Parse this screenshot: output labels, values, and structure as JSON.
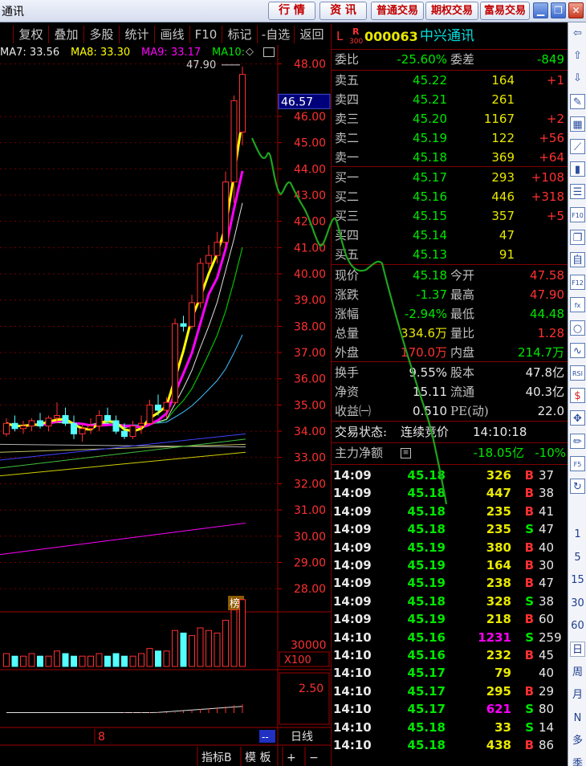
{
  "app": {
    "title_fragment": "通讯"
  },
  "titlebar": {
    "buttons": [
      "行 情",
      "资 讯",
      "普通交易",
      "期权交易",
      "富易交易"
    ],
    "window_controls": [
      "minimize-icon",
      "restore-icon",
      "close-icon"
    ]
  },
  "menu": [
    "复权",
    "叠加",
    "多股",
    "统计",
    "画线",
    "F10",
    "标记",
    "-自选",
    "返回"
  ],
  "ma_legend": [
    {
      "label": "MA7: 33.56",
      "color": "#e8e8e8"
    },
    {
      "label": "MA8: 33.30",
      "color": "#ffff00"
    },
    {
      "label": "MA9: 33.17",
      "color": "#ff00ff"
    },
    {
      "label": "MA10: ",
      "color": "#00e600"
    }
  ],
  "chart_data": {
    "type": "candlestick",
    "price_axis_ticks": [
      "48.00",
      "46.00",
      "45.00",
      "44.00",
      "43.00",
      "42.00",
      "41.00",
      "40.00",
      "39.00",
      "38.00",
      "37.00",
      "36.00",
      "35.00",
      "34.00",
      "33.00",
      "32.00",
      "31.00",
      "30.00",
      "29.00",
      "28.00"
    ],
    "price_range": [
      27.3,
      48.6
    ],
    "current_price_tag": "46.57",
    "high_marker": "47.90",
    "badge": "榜",
    "volume_axis_label": "30000",
    "volume_unit": "X100",
    "indicator_axis_label": "2.50",
    "x_axis_label": "8",
    "period_label": "日线",
    "bottom_buttons": [
      "指标B",
      "模 板",
      "+",
      "−"
    ],
    "scroll_marker": "--",
    "candles": [
      [
        33.9,
        34.5,
        33.8,
        34.3
      ],
      [
        34.3,
        34.6,
        34.0,
        34.1
      ],
      [
        34.1,
        34.4,
        33.9,
        34.2
      ],
      [
        34.2,
        34.5,
        34.0,
        34.4
      ],
      [
        34.4,
        34.7,
        34.1,
        34.2
      ],
      [
        34.2,
        34.6,
        34.0,
        34.5
      ],
      [
        34.5,
        35.1,
        34.3,
        34.6
      ],
      [
        34.6,
        34.9,
        34.2,
        34.3
      ],
      [
        34.3,
        34.6,
        33.7,
        33.9
      ],
      [
        33.9,
        34.3,
        33.6,
        34.1
      ],
      [
        34.1,
        34.5,
        33.9,
        34.2
      ],
      [
        34.2,
        34.8,
        34.0,
        34.6
      ],
      [
        34.6,
        34.9,
        34.3,
        34.4
      ],
      [
        34.4,
        34.6,
        33.9,
        34.0
      ],
      [
        34.0,
        34.3,
        33.7,
        33.8
      ],
      [
        33.8,
        34.4,
        33.7,
        34.2
      ],
      [
        34.2,
        34.6,
        33.9,
        34.3
      ],
      [
        34.3,
        35.2,
        34.2,
        35.0
      ],
      [
        35.0,
        35.4,
        34.6,
        34.8
      ],
      [
        34.8,
        35.3,
        34.5,
        35.1
      ],
      [
        35.1,
        38.3,
        35.0,
        38.1
      ],
      [
        38.1,
        38.4,
        37.8,
        38.0
      ],
      [
        38.0,
        39.2,
        37.9,
        38.9
      ],
      [
        38.9,
        40.6,
        38.7,
        40.4
      ],
      [
        40.4,
        41.1,
        40.2,
        40.7
      ],
      [
        40.7,
        41.6,
        40.4,
        41.2
      ],
      [
        41.2,
        43.9,
        41.0,
        43.5
      ],
      [
        43.5,
        46.8,
        42.7,
        46.6
      ],
      [
        45.4,
        47.9,
        44.9,
        47.6
      ]
    ],
    "volume": [
      5,
      4,
      4,
      5,
      4,
      4,
      6,
      5,
      4,
      4,
      4,
      5,
      4,
      5,
      4,
      4,
      5,
      7,
      6,
      6,
      14,
      13,
      12,
      15,
      14,
      13,
      18,
      22,
      26
    ],
    "annotation_color": "#1fa31f"
  },
  "quote": {
    "prefix": "L",
    "badge_top": "R",
    "badge_bottom": "300",
    "code": "000063",
    "name": "中兴通讯",
    "weibi_label": "委比",
    "weibi": "-25.60%",
    "weicha_label": "委差",
    "weicha": "-849",
    "asks": [
      {
        "label": "卖五",
        "price": "45.22",
        "vol": "164",
        "chg": "+1"
      },
      {
        "label": "卖四",
        "price": "45.21",
        "vol": "261",
        "chg": ""
      },
      {
        "label": "卖三",
        "price": "45.20",
        "vol": "1167",
        "chg": "+2"
      },
      {
        "label": "卖二",
        "price": "45.19",
        "vol": "122",
        "chg": "+56"
      },
      {
        "label": "卖一",
        "price": "45.18",
        "vol": "369",
        "chg": "+64"
      }
    ],
    "bids": [
      {
        "label": "买一",
        "price": "45.17",
        "vol": "293",
        "chg": "+108"
      },
      {
        "label": "买二",
        "price": "45.16",
        "vol": "446",
        "chg": "+318"
      },
      {
        "label": "买三",
        "price": "45.15",
        "vol": "357",
        "chg": "+5"
      },
      {
        "label": "买四",
        "price": "45.14",
        "vol": "47",
        "chg": ""
      },
      {
        "label": "买五",
        "price": "45.13",
        "vol": "91",
        "chg": ""
      }
    ],
    "stats": [
      {
        "l1": "现价",
        "v1": "45.18",
        "c1": "g",
        "l2": "今开",
        "v2": "47.58",
        "c2": "rd"
      },
      {
        "l1": "涨跌",
        "v1": "-1.37",
        "c1": "g",
        "l2": "最高",
        "v2": "47.90",
        "c2": "rd"
      },
      {
        "l1": "涨幅",
        "v1": "-2.94%",
        "c1": "g",
        "l2": "最低",
        "v2": "44.48",
        "c2": "g"
      },
      {
        "l1": "总量",
        "v1": "334.6万",
        "c1": "y",
        "l2": "量比",
        "v2": "1.28",
        "c2": "rd"
      },
      {
        "l1": "外盘",
        "v1": "170.0万",
        "c1": "rd",
        "l2": "内盘",
        "v2": "214.7万",
        "c2": "g"
      }
    ],
    "fundamentals": [
      {
        "l1": "换手",
        "v1": "9.55%",
        "l2": "股本",
        "v2": "47.8亿"
      },
      {
        "l1": "净资",
        "v1": "15.11",
        "l2": "流通",
        "v2": "40.3亿"
      },
      {
        "l1": "收益㈠",
        "v1": "0.510",
        "l2": "PE(动)",
        "v2": "22.0"
      }
    ],
    "trade_status_label": "交易状态:",
    "trade_status": "连续竞价",
    "trade_time": "14:10:18",
    "main_flow_label": "主力净额",
    "main_flow": "-18.05亿",
    "main_flow_pct": "-10%"
  },
  "ticks": [
    {
      "t": "14:09",
      "p": "45.18",
      "v": "326",
      "s": "B",
      "n": "37",
      "vc": "y"
    },
    {
      "t": "14:09",
      "p": "45.18",
      "v": "447",
      "s": "B",
      "n": "38",
      "vc": "y"
    },
    {
      "t": "14:09",
      "p": "45.18",
      "v": "235",
      "s": "B",
      "n": "41",
      "vc": "y"
    },
    {
      "t": "14:09",
      "p": "45.18",
      "v": "235",
      "s": "S",
      "n": "47",
      "vc": "y"
    },
    {
      "t": "14:09",
      "p": "45.19",
      "v": "380",
      "s": "B",
      "n": "40",
      "vc": "y"
    },
    {
      "t": "14:09",
      "p": "45.19",
      "v": "164",
      "s": "B",
      "n": "30",
      "vc": "y"
    },
    {
      "t": "14:09",
      "p": "45.19",
      "v": "238",
      "s": "B",
      "n": "47",
      "vc": "y"
    },
    {
      "t": "14:09",
      "p": "45.18",
      "v": "328",
      "s": "S",
      "n": "38",
      "vc": "y"
    },
    {
      "t": "14:09",
      "p": "45.19",
      "v": "218",
      "s": "B",
      "n": "60",
      "vc": "y"
    },
    {
      "t": "14:10",
      "p": "45.16",
      "v": "1231",
      "s": "S",
      "n": "259",
      "vc": "m"
    },
    {
      "t": "14:10",
      "p": "45.16",
      "v": "232",
      "s": "B",
      "n": "45",
      "vc": "y"
    },
    {
      "t": "14:10",
      "p": "45.17",
      "v": "79",
      "s": "",
      "n": "40",
      "vc": "y"
    },
    {
      "t": "14:10",
      "p": "45.17",
      "v": "295",
      "s": "B",
      "n": "29",
      "vc": "y"
    },
    {
      "t": "14:10",
      "p": "45.17",
      "v": "621",
      "s": "S",
      "n": "80",
      "vc": "m"
    },
    {
      "t": "14:10",
      "p": "45.18",
      "v": "33",
      "s": "S",
      "n": "14",
      "vc": "y"
    },
    {
      "t": "14:10",
      "p": "45.18",
      "v": "438",
      "s": "B",
      "n": "86",
      "vc": "y"
    }
  ],
  "sidebar": {
    "icons": [
      "arrow-left-icon",
      "arrow-up-icon",
      "arrow-down-icon",
      "note-icon",
      "grid-icon",
      "line-chart-icon",
      "kline-icon",
      "list-icon",
      "f10-icon",
      "news-icon",
      "self-select-icon",
      "f12-icon",
      "formula-icon",
      "circle-icon",
      "wave-icon",
      "rsi-icon",
      "money-icon",
      "move-icon",
      "pencil-icon",
      "f5-icon",
      "refresh-icon"
    ],
    "periods": [
      "1",
      "5",
      "15",
      "30",
      "60",
      "日",
      "周",
      "月",
      "N",
      "多",
      "季"
    ]
  }
}
